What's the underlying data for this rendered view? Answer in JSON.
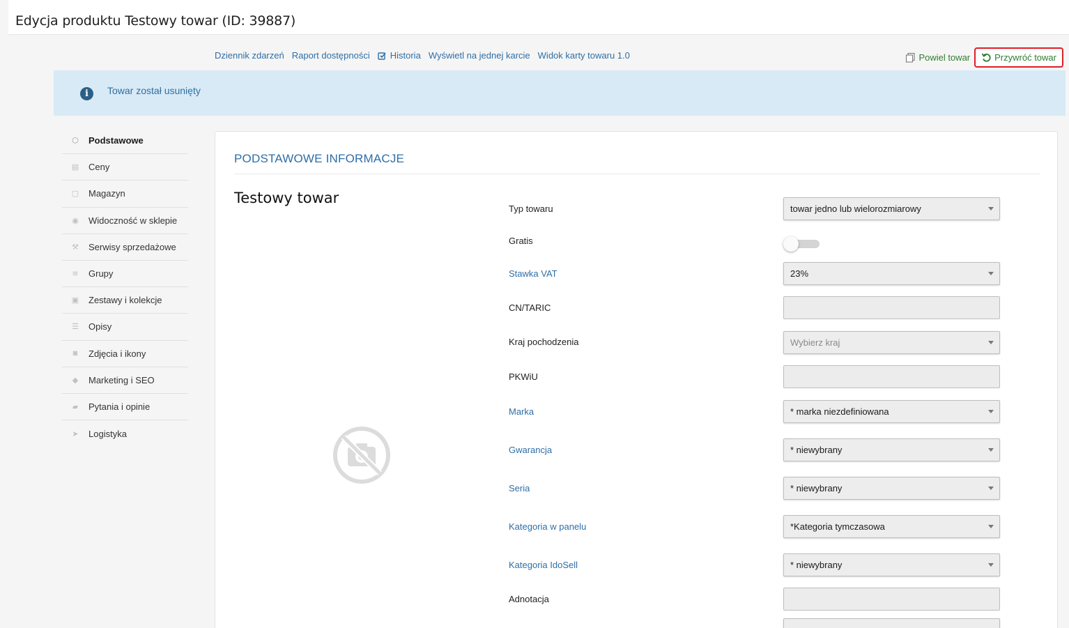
{
  "header": {
    "title": "Edycja produktu Testowy towar (ID: 39887)"
  },
  "top_links": [
    {
      "label": "Dziennik zdarzeń"
    },
    {
      "label": "Raport dostępności"
    },
    {
      "label": "Historia",
      "icon": "edit-check-icon"
    },
    {
      "label": "Wyświetl na jednej karcie"
    },
    {
      "label": "Widok karty towaru 1.0"
    }
  ],
  "actions": {
    "copy_label": "Powiel towar",
    "restore_label": "Przywróć towar"
  },
  "banner": {
    "text": "Towar został usunięty",
    "icon": "info-icon"
  },
  "sidebar": {
    "items": [
      {
        "label": "Podstawowe",
        "icon": "box-icon",
        "active": true
      },
      {
        "label": "Ceny",
        "icon": "coins-icon"
      },
      {
        "label": "Magazyn",
        "icon": "calendar-icon"
      },
      {
        "label": "Widoczność w sklepie",
        "icon": "eye-icon"
      },
      {
        "label": "Serwisy sprzedażowe",
        "icon": "gavel-icon"
      },
      {
        "label": "Grupy",
        "icon": "layers-icon"
      },
      {
        "label": "Zestawy i kolekcje",
        "icon": "images-icon"
      },
      {
        "label": "Opisy",
        "icon": "text-lines-icon"
      },
      {
        "label": "Zdjęcia i ikony",
        "icon": "camera-icon"
      },
      {
        "label": "Marketing i SEO",
        "icon": "tag-icon"
      },
      {
        "label": "Pytania i opinie",
        "icon": "comments-icon"
      },
      {
        "label": "Logistyka",
        "icon": "paper-plane-icon"
      }
    ]
  },
  "card": {
    "section_title": "PODSTAWOWE INFORMACJE",
    "product_name": "Testowy towar",
    "fields": {
      "typ_towaru": {
        "label": "Typ towaru",
        "value": "towar jedno lub wielorozmiarowy"
      },
      "gratis": {
        "label": "Gratis",
        "value": "off"
      },
      "stawka_vat": {
        "label": "Stawka VAT",
        "value": "23%"
      },
      "cn_taric": {
        "label": "CN/TARIC",
        "value": ""
      },
      "kraj": {
        "label": "Kraj pochodzenia",
        "placeholder": "Wybierz kraj"
      },
      "pkwiu": {
        "label": "PKWiU",
        "value": ""
      },
      "marka": {
        "label": "Marka",
        "value": "* marka niezdefiniowana"
      },
      "gwarancja": {
        "label": "Gwarancja",
        "value": "* niewybrany"
      },
      "seria": {
        "label": "Seria",
        "value": "* niewybrany"
      },
      "kategoria_panel": {
        "label": "Kategoria w panelu",
        "value": "*Kategoria tymczasowa"
      },
      "kategoria_idosell": {
        "label": "Kategoria IdoSell",
        "value": "* niewybrany"
      },
      "adnotacja": {
        "label": "Adnotacja",
        "value": ""
      }
    }
  },
  "colors": {
    "link": "#2f6ea5",
    "banner_bg": "#d8eaf6",
    "restore_border": "#e01e26",
    "action_green": "#2e7d32"
  }
}
